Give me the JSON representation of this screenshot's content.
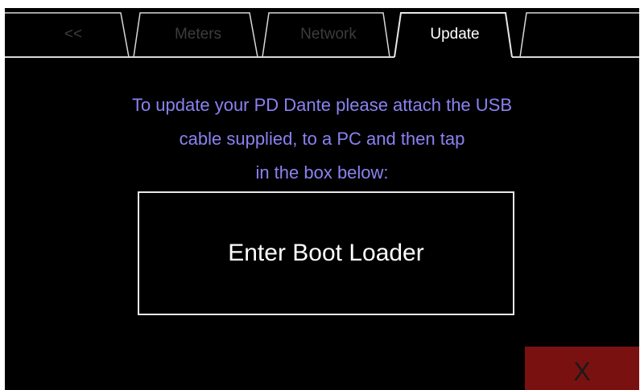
{
  "tabs": [
    {
      "label": "<<",
      "state": "inactive"
    },
    {
      "label": "Meters",
      "state": "inactive"
    },
    {
      "label": "Network",
      "state": "inactive"
    },
    {
      "label": "Update",
      "state": "active"
    },
    {
      "label": "",
      "state": "inactive"
    }
  ],
  "message": {
    "line1": "To update your PD Dante please attach the USB",
    "line2": "cable supplied, to a PC and then tap",
    "line3": "in the box below:"
  },
  "boot_button": {
    "label": "Enter Boot Loader"
  },
  "close_button": {
    "label": "X"
  },
  "colors": {
    "background": "#000000",
    "message_text": "#8a82f0",
    "inactive_tab_text": "#3c3c3c",
    "tab_outline": "#d8d8d8",
    "close_button_bg": "#7a1111"
  }
}
